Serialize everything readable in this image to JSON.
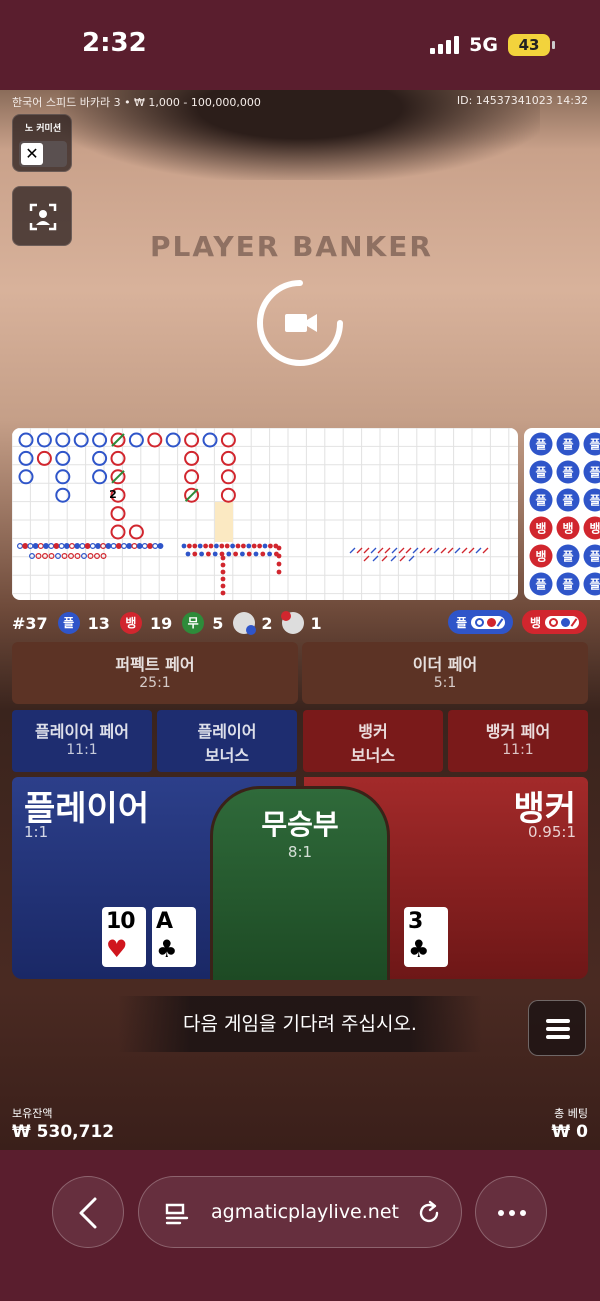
{
  "status_bar": {
    "time": "2:32",
    "network": "5G",
    "battery": "43"
  },
  "game": {
    "info": "한국어 스피드 바카라 3 • ₩ 1,000 - 100,000,000",
    "id": "ID: 14537341023 14:32",
    "table_text": "PLAYER   BANKER",
    "no_commission_label": "노 커미션"
  },
  "stats": {
    "round": "#37",
    "player_badge": "플",
    "player_count": "13",
    "banker_badge": "뱅",
    "banker_count": "19",
    "tie_badge": "무",
    "tie_count": "5",
    "player_pair_count": "2",
    "banker_pair_count": "1",
    "predict_player": "플",
    "predict_banker": "뱅"
  },
  "side_road": [
    [
      "플",
      "플",
      "플"
    ],
    [
      "플",
      "플",
      "플"
    ],
    [
      "플",
      "플",
      "플"
    ],
    [
      "뱅",
      "뱅",
      "뱅"
    ],
    [
      "뱅",
      "플",
      "플"
    ],
    [
      "플",
      "플",
      "플"
    ]
  ],
  "bets": {
    "perfect_pair": {
      "label": "퍼펙트 페어",
      "odds": "25:1"
    },
    "either_pair": {
      "label": "이더 페어",
      "odds": "5:1"
    },
    "player_pair": {
      "label": "플레이어 페어",
      "odds": "11:1"
    },
    "player_bonus": {
      "line1": "플레이어",
      "line2": "보너스"
    },
    "banker_bonus": {
      "line1": "뱅커",
      "line2": "보너스"
    },
    "banker_pair": {
      "label": "뱅커 페어",
      "odds": "11:1"
    },
    "player": {
      "label": "플레이어",
      "odds": "1:1"
    },
    "tie": {
      "label": "무승부",
      "odds": "8:1"
    },
    "banker": {
      "label": "뱅커",
      "odds": "0.95:1"
    }
  },
  "cards": {
    "player": [
      {
        "rank": "10",
        "suit": "♥",
        "color": "#d0161e"
      },
      {
        "rank": "A",
        "suit": "♣",
        "color": "#000000"
      }
    ],
    "banker": [
      {
        "rank": "3",
        "suit": "♣",
        "color": "#000000"
      }
    ]
  },
  "message": "다음 게임을 기다려 주십시오.",
  "balance": {
    "label": "보유잔액",
    "value": "₩ 530,712"
  },
  "total_bet": {
    "label": "총 베팅",
    "value": "₩ 0"
  },
  "browser": {
    "url": "agmaticplaylive.net"
  },
  "colors": {
    "player": "#2f55c9",
    "banker": "#d1262e",
    "tie": "#2e8b3a"
  }
}
